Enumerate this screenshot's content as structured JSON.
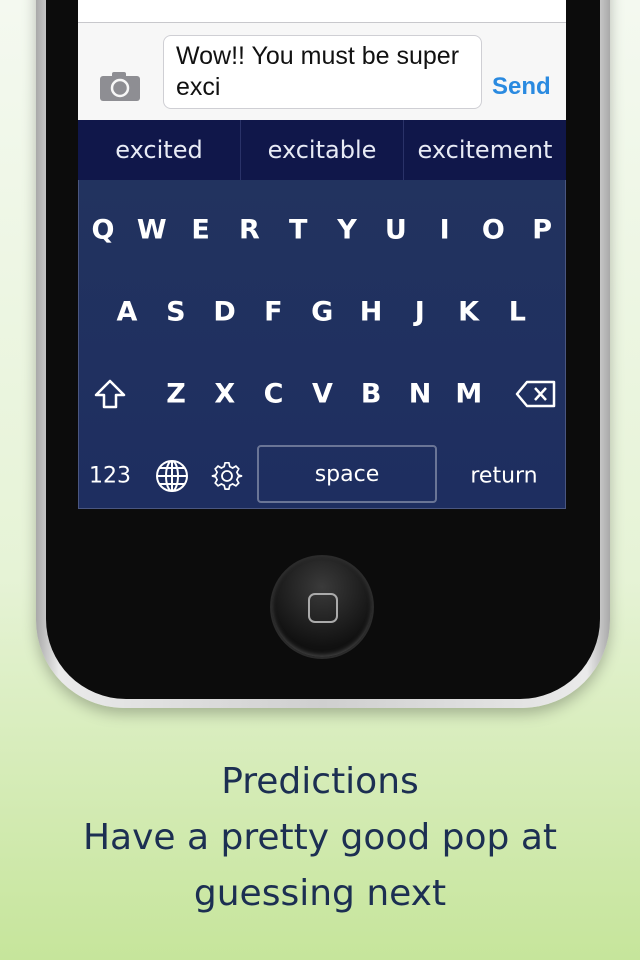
{
  "message": {
    "text": "Wow!! You must be super exci",
    "send_label": "Send",
    "camera_icon": "camera-icon"
  },
  "suggestions": [
    "excited",
    "excitable",
    "excitement"
  ],
  "keyboard": {
    "row1": [
      "Q",
      "W",
      "E",
      "R",
      "T",
      "Y",
      "U",
      "I",
      "O",
      "P"
    ],
    "row2": [
      "A",
      "S",
      "D",
      "F",
      "G",
      "H",
      "J",
      "K",
      "L"
    ],
    "row3": [
      "Z",
      "X",
      "C",
      "V",
      "B",
      "N",
      "M"
    ],
    "numbers_label": "123",
    "space_label": "space",
    "return_label": "return",
    "icons": [
      "shift-icon",
      "backspace-icon",
      "globe-icon",
      "gear-icon"
    ],
    "colors": {
      "suggestion_bar": "#10174a",
      "keyboard": "#1f2f5e"
    }
  },
  "caption": {
    "title": "Predictions",
    "line1": "Have a pretty good pop at",
    "line2": "guessing next"
  }
}
